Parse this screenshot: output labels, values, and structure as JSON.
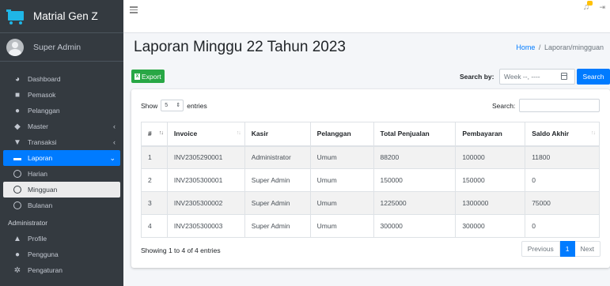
{
  "brand": {
    "name": "Matrial Gen Z"
  },
  "user": {
    "name": "Super Admin"
  },
  "sidebar": {
    "items": [
      {
        "label": "Dashboard",
        "icon": "tachometer-icon"
      },
      {
        "label": "Pemasok",
        "icon": "truck-icon"
      },
      {
        "label": "Pelanggan",
        "icon": "users-icon"
      },
      {
        "label": "Master",
        "icon": "box-icon",
        "arrow": "‹"
      },
      {
        "label": "Transaksi",
        "icon": "cart-icon",
        "arrow": "‹"
      },
      {
        "label": "Laporan",
        "icon": "report-icon",
        "arrow": "⌄"
      },
      {
        "label": "Harian",
        "icon": "circle-icon"
      },
      {
        "label": "Mingguan",
        "icon": "circle-icon"
      },
      {
        "label": "Bulanan",
        "icon": "circle-icon"
      }
    ],
    "header_admin": "Administrator",
    "admin_items": [
      {
        "label": "Profile",
        "icon": "user-icon"
      },
      {
        "label": "Pengguna",
        "icon": "users-icon"
      },
      {
        "label": "Pengaturan",
        "icon": "gear-icon"
      }
    ]
  },
  "header": {
    "title": "Laporan Minggu 22 Tahun 2023",
    "breadcrumb_home": "Home",
    "breadcrumb_sep": "/",
    "breadcrumb_current": "Laporan/mingguan"
  },
  "toolbar": {
    "export_label": "Export",
    "search_by_label": "Search by:",
    "week_placeholder": "Week --, ----",
    "search_button": "Search"
  },
  "table": {
    "show_label": "Show",
    "entries_value": "5",
    "entries_label": "entries",
    "search_label": "Search:",
    "columns": [
      "#",
      "Invoice",
      "Kasir",
      "Pelanggan",
      "Total Penjualan",
      "Pembayaran",
      "Saldo Akhir"
    ],
    "rows": [
      [
        "1",
        "INV2305290001",
        "Administrator",
        "Umum",
        "88200",
        "100000",
        "11800"
      ],
      [
        "2",
        "INV2305300001",
        "Super Admin",
        "Umum",
        "150000",
        "150000",
        "0"
      ],
      [
        "3",
        "INV2305300002",
        "Super Admin",
        "Umum",
        "1225000",
        "1300000",
        "75000"
      ],
      [
        "4",
        "INV2305300003",
        "Super Admin",
        "Umum",
        "300000",
        "300000",
        "0"
      ]
    ],
    "info": "Showing 1 to 4 of 4 entries",
    "pagination": {
      "previous": "Previous",
      "current": "1",
      "next": "Next"
    }
  },
  "colors": {
    "sidebar_bg": "#343a40",
    "accent": "#007bff",
    "export_green": "#28a745",
    "badge": "#ffc107"
  }
}
